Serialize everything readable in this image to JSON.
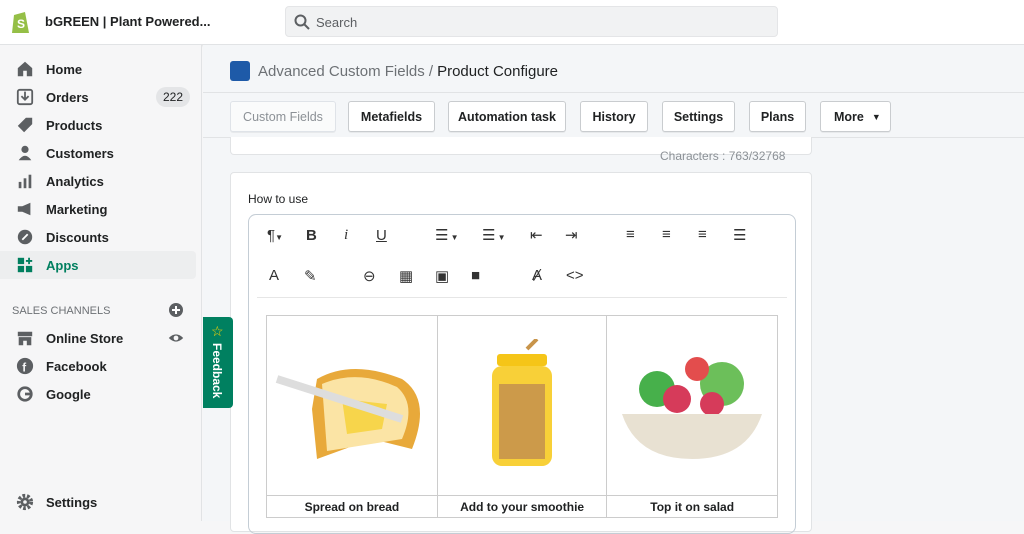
{
  "topbar": {
    "store_name": "bGREEN | Plant Powered...",
    "search_placeholder": "Search"
  },
  "sidebar": {
    "items": [
      {
        "label": "Home"
      },
      {
        "label": "Orders",
        "badge": "222"
      },
      {
        "label": "Products"
      },
      {
        "label": "Customers"
      },
      {
        "label": "Analytics"
      },
      {
        "label": "Marketing"
      },
      {
        "label": "Discounts"
      },
      {
        "label": "Apps",
        "active": true
      }
    ],
    "sales_channels_title": "SALES CHANNELS",
    "channels": [
      {
        "label": "Online Store"
      },
      {
        "label": "Facebook"
      },
      {
        "label": "Google"
      }
    ],
    "settings": "Settings"
  },
  "breadcrumb": {
    "app": "Advanced Custom Fields",
    "separator": "/",
    "page": "Product Configure"
  },
  "tabs": [
    {
      "label": "Custom Fields",
      "disabled": true
    },
    {
      "label": "Metafields"
    },
    {
      "label": "Automation task"
    },
    {
      "label": "History"
    },
    {
      "label": "Settings"
    },
    {
      "label": "Plans"
    },
    {
      "label": "More"
    }
  ],
  "characters": "Characters : 763/32768",
  "field": {
    "label": "How to use"
  },
  "table": {
    "captions": [
      "Spread on bread",
      "Add to your smoothie",
      "Top it on salad"
    ]
  },
  "feedback": "Feedback",
  "colors": {
    "accent": "#008060",
    "active_nav": "#007f5f"
  }
}
